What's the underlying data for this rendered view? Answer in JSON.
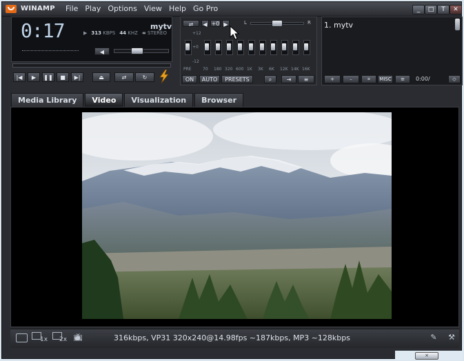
{
  "app": {
    "title": "WINAMP"
  },
  "menu": [
    "File",
    "Play",
    "Options",
    "View",
    "Help",
    "Go Pro"
  ],
  "window_buttons": [
    "_",
    "□",
    "T",
    "✕"
  ],
  "player": {
    "time": "0:17",
    "song": "mytv",
    "bitrate": "313",
    "bitrate_unit": "KBPS",
    "samplerate": "44",
    "samplerate_unit": "KHZ",
    "stereo": "STEREO",
    "volume_pct": 40,
    "balance_pct": 50
  },
  "transport": [
    "|◀",
    "▶",
    "❚❚",
    "■",
    "▶|",
    "⏏"
  ],
  "equalizer": {
    "toggle": "ON",
    "auto": "AUTO",
    "presets": "PRESETS",
    "pre_label": "PRE",
    "preamp_top": "+12",
    "preamp_mid": "+0",
    "preamp_bot": "-12",
    "bands": [
      "70",
      "180",
      "320",
      "600",
      "1K",
      "3K",
      "6K",
      "12K",
      "14K",
      "16K"
    ],
    "balance_left": "L",
    "balance_right": "R"
  },
  "playlist": {
    "items": [
      "1. mytv"
    ],
    "buttons": [
      "+",
      "–",
      "⌗",
      "MISC",
      "≡"
    ],
    "time": "0:00/"
  },
  "tabs": [
    "Media Library",
    "Video",
    "Visualization",
    "Browser"
  ],
  "active_tab": "Video",
  "status": {
    "text": "316kbps, VP31 320x240@14.98fps ~187kbps, MP3 ~128kbps",
    "zoom_1x": "1x",
    "zoom_2x": "2x"
  },
  "colors": {
    "accent": "#e46a17",
    "chrome": "#2a2c31",
    "lcd_text": "#bfd3e8"
  }
}
